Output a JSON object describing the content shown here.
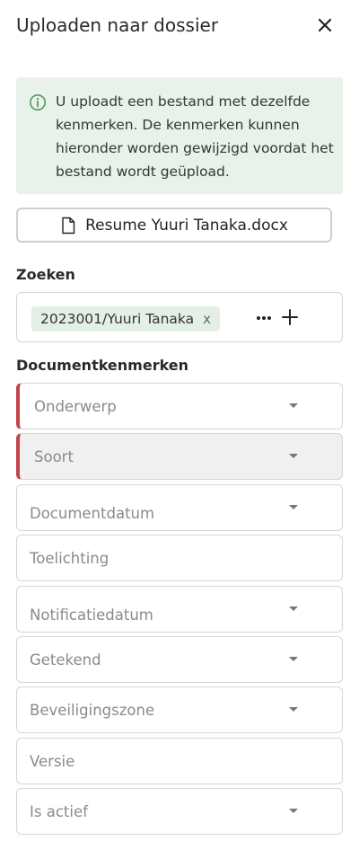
{
  "header": {
    "title": "Uploaden naar dossier",
    "close_icon": "close-icon"
  },
  "info": {
    "icon": "info-circle-icon",
    "text": "U uploadt een bestand met dezelfde kenmerken. De kenmerken kunnen hieronder worden gewijzigd voordat het bestand wordt geüpload.",
    "background": "#e8f1ea"
  },
  "file": {
    "icon": "document-icon",
    "name": "Resume Yuuri Tanaka.docx"
  },
  "search": {
    "label": "Zoeken",
    "chip_label": "2023001/Yuuri Tanaka",
    "chip_remove": "x",
    "more_icon": "more-horizontal-icon",
    "add_icon": "plus-icon"
  },
  "properties": {
    "label": "Documentkenmerken",
    "required_color": "#c0454b",
    "fields": [
      {
        "label": "Onderwerp",
        "dropdown": true,
        "required": true
      },
      {
        "label": "Soort",
        "dropdown": true,
        "required": true,
        "disabled": true
      },
      {
        "label": "Documentdatum",
        "dropdown": true
      },
      {
        "label": "Toelichting",
        "dropdown": false
      },
      {
        "label": "Notificatiedatum",
        "dropdown": true
      },
      {
        "label": "Getekend",
        "dropdown": true
      },
      {
        "label": "Beveiligingszone",
        "dropdown": true
      },
      {
        "label": "Versie",
        "dropdown": false
      },
      {
        "label": "Is actief",
        "dropdown": true
      }
    ]
  }
}
